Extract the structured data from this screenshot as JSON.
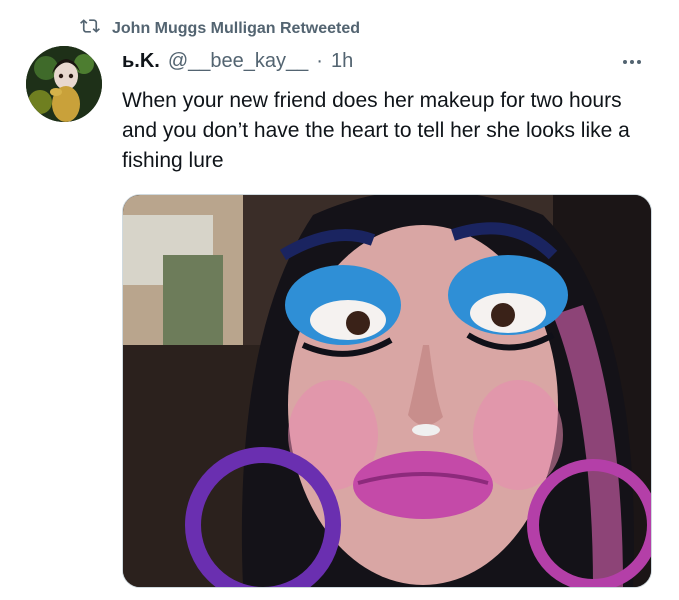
{
  "retweet": {
    "icon": "retweet-icon",
    "label": "John Muggs Mulligan Retweeted"
  },
  "tweet": {
    "display_name": "ь.K.",
    "handle": "@__bee_kay__",
    "separator": "·",
    "time": "1h",
    "more_icon": "more-icon",
    "text": "When your new friend does her makeup for two hours and you don’t have the heart to tell her she looks like a fishing lure"
  },
  "colors": {
    "secondary_text": "#536471",
    "primary_text": "#0f1419",
    "border": "#cfd9de"
  }
}
